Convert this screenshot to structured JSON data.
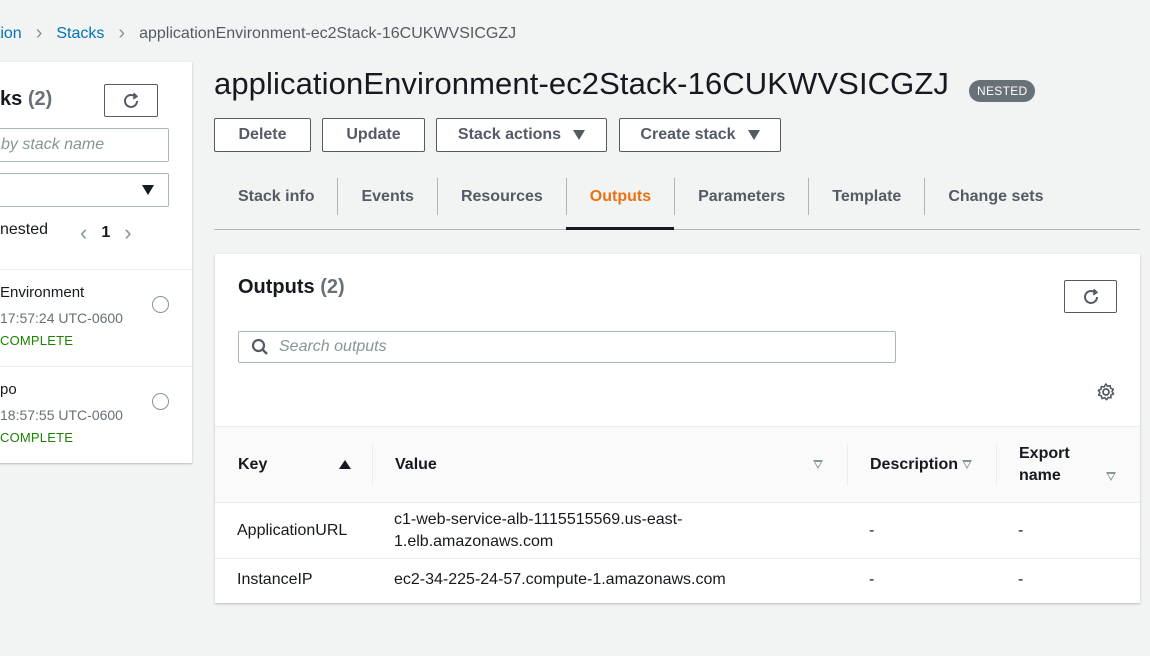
{
  "breadcrumb": {
    "items": [
      "ation",
      "Stacks",
      "applicationEnvironment-ec2Stack-16CUKWVSICGZJ"
    ]
  },
  "left_panel": {
    "title": "ks",
    "count": "(2)",
    "search_placeholder": "by stack name",
    "filter_label": "nested",
    "page": "1",
    "stacks": [
      {
        "name": "Environment",
        "time": "17:57:24 UTC-0600",
        "status": "COMPLETE"
      },
      {
        "name": "po",
        "time": "18:57:55 UTC-0600",
        "status": "COMPLETE"
      }
    ]
  },
  "header": {
    "title": "applicationEnvironment-ec2Stack-16CUKWVSICGZJ",
    "badge": "NESTED",
    "buttons": {
      "delete": "Delete",
      "update": "Update",
      "stack_actions": "Stack actions",
      "create_stack": "Create stack"
    }
  },
  "tabs": [
    "Stack info",
    "Events",
    "Resources",
    "Outputs",
    "Parameters",
    "Template",
    "Change sets"
  ],
  "active_tab": "Outputs",
  "outputs": {
    "title": "Outputs",
    "count": "(2)",
    "search_placeholder": "Search outputs",
    "columns": {
      "key": "Key",
      "value": "Value",
      "description": "Description",
      "export_line1": "Export",
      "export_line2": "name"
    },
    "rows": [
      {
        "key": "ApplicationURL",
        "value_line1": "c1-web-service-alb-1115515569.us-east-",
        "value_line2": "1.elb.amazonaws.com",
        "description": "-",
        "export": "-"
      },
      {
        "key": "InstanceIP",
        "value": "ec2-34-225-24-57.compute-1.amazonaws.com",
        "description": "-",
        "export": "-"
      }
    ]
  },
  "colors": {
    "link": "#0073bb",
    "active_tab": "#ec7211",
    "success": "#1d8102",
    "badge_bg": "#687078"
  }
}
